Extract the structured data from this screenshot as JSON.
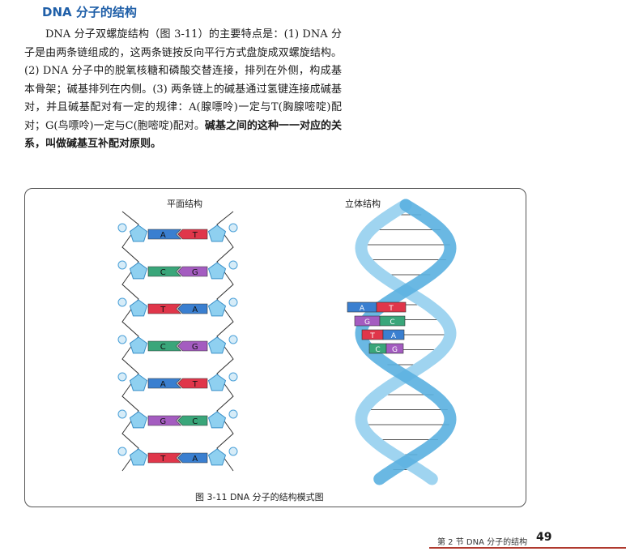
{
  "section": {
    "title": "DNA 分子的结构"
  },
  "paragraph": {
    "normal": "DNA 分子双螺旋结构（图 3-11）的主要特点是：(1) DNA 分子是由两条链组成的，这两条链按反向平行方式盘旋成双螺旋结构。(2) DNA 分子中的脱氧核糖和磷酸交替连接，排列在外侧，构成基本骨架；碱基排列在内侧。(3) 两条链上的碱基通过氢键连接成碱基对，并且碱基配对有一定的规律：A(腺嘌呤)一定与T(胸腺嘧啶)配对；G(鸟嘌呤)一定与C(胞嘧啶)配对。",
    "bold": "碱基之间的这种一一对应的关系，叫做碱基互补配对原则。"
  },
  "figure": {
    "left_label": "平面结构",
    "right_label": "立体结构",
    "caption": "图 3-11   DNA 分子的结构模式图",
    "pairs_planar": [
      {
        "left": "A",
        "right": "T"
      },
      {
        "left": "C",
        "right": "G"
      },
      {
        "left": "T",
        "right": "A"
      },
      {
        "left": "C",
        "right": "G"
      },
      {
        "left": "A",
        "right": "T"
      },
      {
        "left": "G",
        "right": "C"
      },
      {
        "left": "T",
        "right": "A"
      }
    ],
    "pairs_helix": [
      {
        "left": "A",
        "right": "T"
      },
      {
        "left": "G",
        "right": "C"
      },
      {
        "left": "T",
        "right": "A"
      },
      {
        "left": "C",
        "right": "G"
      }
    ],
    "base_colors": {
      "A": "#3a7fd0",
      "T": "#e0364a",
      "C": "#3aa67a",
      "G": "#a45cc0"
    },
    "backbone_color": "#5ab0e0"
  },
  "footer": {
    "section_text": "第 2 节  DNA 分子的结构",
    "page_number": "49"
  }
}
